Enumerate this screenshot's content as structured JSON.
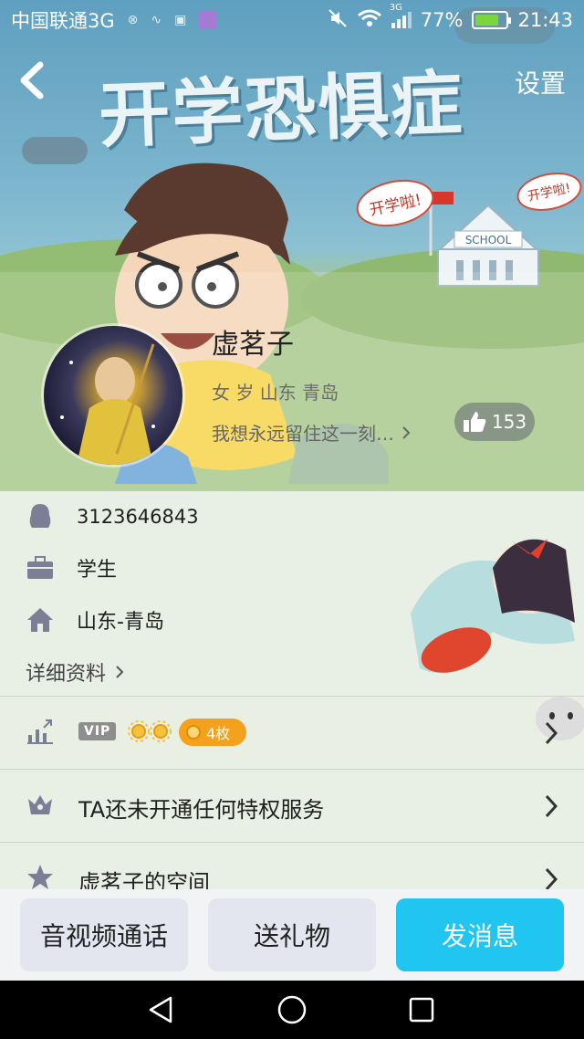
{
  "status_bar": {
    "carrier": "中国联通3G",
    "network": "3G",
    "battery": "77%",
    "battery_level": 0.77,
    "time": "21:43"
  },
  "nav": {
    "settings_label": "设置"
  },
  "header": {
    "banner_title": "开学恐惧症",
    "bubble_left": "开学啦!",
    "bubble_right": "开学啦!",
    "school_sign": "SCHOOL"
  },
  "profile": {
    "nickname": "虚茗子",
    "gender_location": "女 岁 山东 青岛",
    "signature": "我想永远留住这一刻…",
    "likes": "153"
  },
  "info": {
    "qq_number": "3123646843",
    "occupation": "学生",
    "hometown": "山东-青岛",
    "detail_link": "详细资料"
  },
  "vip_row": {
    "vip_label": "VIP",
    "coins": "4枚"
  },
  "privilege_row": {
    "label": "TA还未开通任何特权服务"
  },
  "space_row": {
    "label": "虚茗子的空间"
  },
  "actions": {
    "call": "音视频通话",
    "gift": "送礼物",
    "message": "发消息"
  },
  "colors": {
    "accent": "#20c6ef",
    "coin_pill": "#f4a21e",
    "hero_sky": "#6ea9c4",
    "hero_grass": "#a7c98c"
  }
}
